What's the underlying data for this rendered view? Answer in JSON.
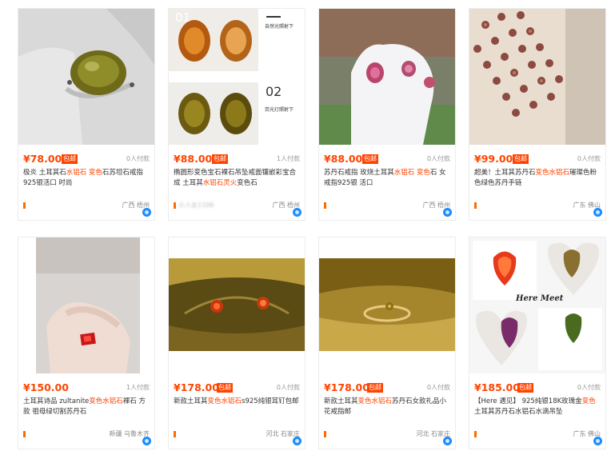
{
  "products": [
    {
      "price": "¥78.00",
      "badge": "包邮",
      "paid": "0人付款",
      "title_a": "极炎 土耳其石",
      "title_h1": "水铝石 变色",
      "title_b": "石苏坦石戒指 925银活口 时尚",
      "shop": "",
      "location": "广西 梧州"
    },
    {
      "price": "¥88.00",
      "badge": "包邮",
      "paid": "1人付款",
      "title_a": "椭圆形变色宝石裸石吊坠戒面镶嵌彩宝合成 土耳其",
      "title_h1": "水铝石灵火",
      "title_b": "变色石",
      "shop": "小人女1106",
      "location": "广西 梧州"
    },
    {
      "price": "¥88.00",
      "badge": "包邮",
      "paid": "0人付款",
      "title_a": "苏丹石戒指 玫烧土耳其",
      "title_h1": "水铝石 变色",
      "title_b": "石 女戒指925银 活口",
      "shop": "",
      "location": "广西 梧州"
    },
    {
      "price": "¥99.00",
      "badge": "包邮",
      "paid": "0人付款",
      "title_a": "超美！土耳其苏丹石",
      "title_h1": "变色水铝石",
      "title_b": "璀璨色粉色绿色苏丹手链",
      "shop": "",
      "location": "广东 佛山"
    },
    {
      "price": "¥150.00",
      "badge": "",
      "paid": "1人付款",
      "title_a": "土耳其诗品 zultanite",
      "title_h1": "变色水铝石",
      "title_b": "裸石 方款 祖母绿切割苏丹石",
      "shop": "",
      "location": "新疆 乌鲁木齐"
    },
    {
      "price": "¥178.00",
      "badge": "包邮",
      "paid": "0人付款",
      "title_a": "新款土耳其",
      "title_h1": "变色水铝石",
      "title_b": "s925纯银耳钉包邮",
      "shop": "",
      "location": "河北 石家庄"
    },
    {
      "price": "¥178.00",
      "badge": "包邮",
      "paid": "0人付款",
      "title_a": "新款土耳其",
      "title_h1": "变色水铝石",
      "title_b": "苏丹石女款礼品小花戒指邮",
      "shop": "",
      "location": "河北 石家庄"
    },
    {
      "price": "¥185.00",
      "badge": "包邮",
      "paid": "0人付款",
      "title_a": "【Here 遇见】 925纯银18K玫瑰金",
      "title_h1": "变色",
      "title_b": "土耳其苏丹石水铝石水滴吊坠",
      "shop": "",
      "location": "广东 佛山"
    }
  ],
  "image_labels": {
    "p2_top_num": "01",
    "p2_top_caption": "自然光照射下",
    "p2_bot_num": "02",
    "p2_bot_caption": "荧光灯照射下",
    "p8_caption": "Here Meet"
  }
}
